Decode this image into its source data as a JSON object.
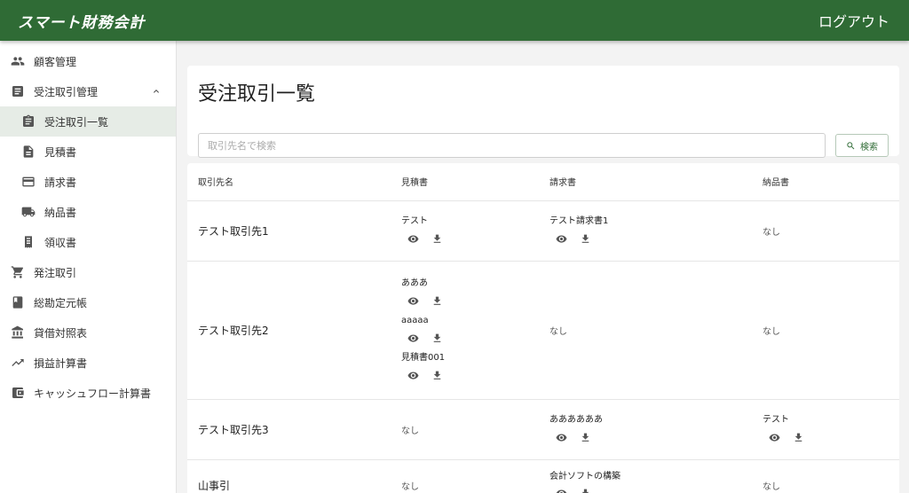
{
  "app": {
    "brand": "スマート財務会計",
    "logout_label": "ログアウト"
  },
  "sidebar": {
    "items": [
      {
        "label": "顧客管理",
        "icon": "people-icon"
      },
      {
        "label": "受注取引管理",
        "icon": "list-icon"
      },
      {
        "label": "受注取引一覧",
        "icon": "clipboard-icon"
      },
      {
        "label": "見積書",
        "icon": "file-icon"
      },
      {
        "label": "請求書",
        "icon": "credit-card-icon"
      },
      {
        "label": "納品書",
        "icon": "truck-icon"
      },
      {
        "label": "領収書",
        "icon": "receipt-icon"
      },
      {
        "label": "発注取引",
        "icon": "cart-icon"
      },
      {
        "label": "総勘定元帳",
        "icon": "book-icon"
      },
      {
        "label": "貸借対照表",
        "icon": "bank-icon"
      },
      {
        "label": "損益計算書",
        "icon": "trending-up-icon"
      },
      {
        "label": "キャッシュフロー計算書",
        "icon": "wallet-icon"
      }
    ]
  },
  "page": {
    "title": "受注取引一覧",
    "search_placeholder": "取引先名で検索",
    "search_button": "検索"
  },
  "table": {
    "headers": [
      "取引先名",
      "見積書",
      "請求書",
      "納品書"
    ],
    "none_label": "なし",
    "rows": [
      {
        "client": "テスト取引先1",
        "estimates": [
          "テスト"
        ],
        "invoices": [
          "テスト請求書1"
        ],
        "deliveries": []
      },
      {
        "client": "テスト取引先2",
        "estimates": [
          "あああ",
          "aaaaa",
          "見積書001"
        ],
        "invoices": [],
        "deliveries": []
      },
      {
        "client": "テスト取引先3",
        "estimates": [],
        "invoices": [
          "ああああああ"
        ],
        "deliveries": [
          "テスト"
        ]
      },
      {
        "client": "山事引",
        "estimates": [],
        "invoices": [
          "会計ソフトの構築"
        ],
        "deliveries": []
      }
    ]
  }
}
